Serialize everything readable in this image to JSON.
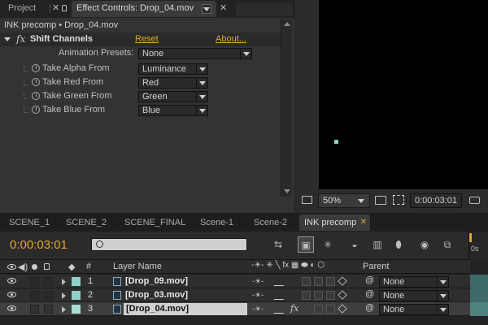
{
  "effect_controls": {
    "tab_project": "Project",
    "tab_title": "Effect Controls: Drop_04.mov",
    "breadcrumb": "INK precomp • Drop_04.mov",
    "fx_badge": "fx",
    "effect_name": "Shift Channels",
    "reset_label": "Reset",
    "about_label": "About...",
    "presets_label": "Animation Presets:",
    "presets_value": "None",
    "properties": [
      {
        "label": "Take Alpha From",
        "value": "Luminance"
      },
      {
        "label": "Take Red From",
        "value": "Red"
      },
      {
        "label": "Take Green From",
        "value": "Green"
      },
      {
        "label": "Take Blue From",
        "value": "Blue"
      }
    ]
  },
  "composition": {
    "zoom": "50%",
    "timecode": "0:00:03:01"
  },
  "timeline": {
    "tabs": [
      "SCENE_1",
      "SCENE_2",
      "SCENE_FINAL",
      "Scene-1",
      "Scene-2",
      "INK precomp"
    ],
    "current_time": "0:00:03:01",
    "search_placeholder": "",
    "col_number": "#",
    "col_layer_name": "Layer Name",
    "col_parent": "Parent",
    "ruler_label": "0s",
    "layers": [
      {
        "num": "1",
        "name": "[Drop_09.mov]",
        "parent": "None",
        "color": "#8fd0c8",
        "selected": false,
        "fx": ""
      },
      {
        "num": "2",
        "name": "[Drop_03.mov]",
        "parent": "None",
        "color": "#8fd0c8",
        "selected": false,
        "fx": ""
      },
      {
        "num": "3",
        "name": "[Drop_04.mov]",
        "parent": "None",
        "color": "#a8dcd2",
        "selected": true,
        "fx": "fx"
      }
    ]
  },
  "colors": {
    "accent": "#e3a630",
    "timecode": "#e3a630",
    "label_teal": "#8fd0c8"
  }
}
